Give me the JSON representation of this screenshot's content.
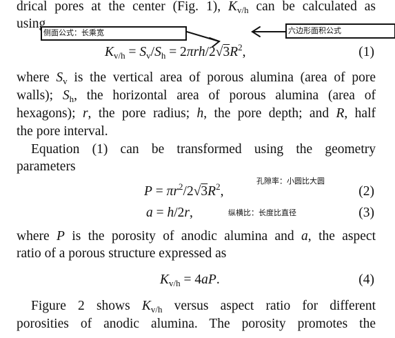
{
  "paragraph1": {
    "line1_before": "drical pores at the center (Fig. 1), ",
    "K": "K",
    "vh": "v/h",
    "line1_after": " can be calculated as",
    "line2": "using"
  },
  "annotations": {
    "side_area_formula": "侧面公式：长乘宽",
    "hexagon_area_formula": "六边形面积公式",
    "porosity_note": "孔隙率：小圆比大圆",
    "aspect_ratio_note": "纵横比：长度比直径"
  },
  "equation1": {
    "number": "(1)"
  },
  "paragraph2": {
    "lines": [
      "where S_v is the vertical area of porous alumina (area of pore",
      "walls); S_h, the horizontal area of porous alumina (area of",
      "hexagons); r, the pore radius; h, the pore depth; and R, half",
      "the pore interval."
    ]
  },
  "paragraph3": {
    "line1": "Equation (1) can be transformed using the geometry",
    "line2": "parameters"
  },
  "equation2": {
    "number": "(2)"
  },
  "equation3": {
    "number": "(3)"
  },
  "paragraph4": {
    "line1_where": "where ",
    "P": "P",
    "line1_mid": " is the porosity of anodic alumina and ",
    "a": "a",
    "line1_end": ", the aspect",
    "line2": "ratio of a porous structure expressed as"
  },
  "equation4": {
    "number": "(4)"
  },
  "paragraph5": {
    "line1_start": "Figure 2 shows ",
    "line1_end": " versus aspect ratio for different",
    "line2": "porosities of anodic alumina. The porosity promotes the"
  }
}
